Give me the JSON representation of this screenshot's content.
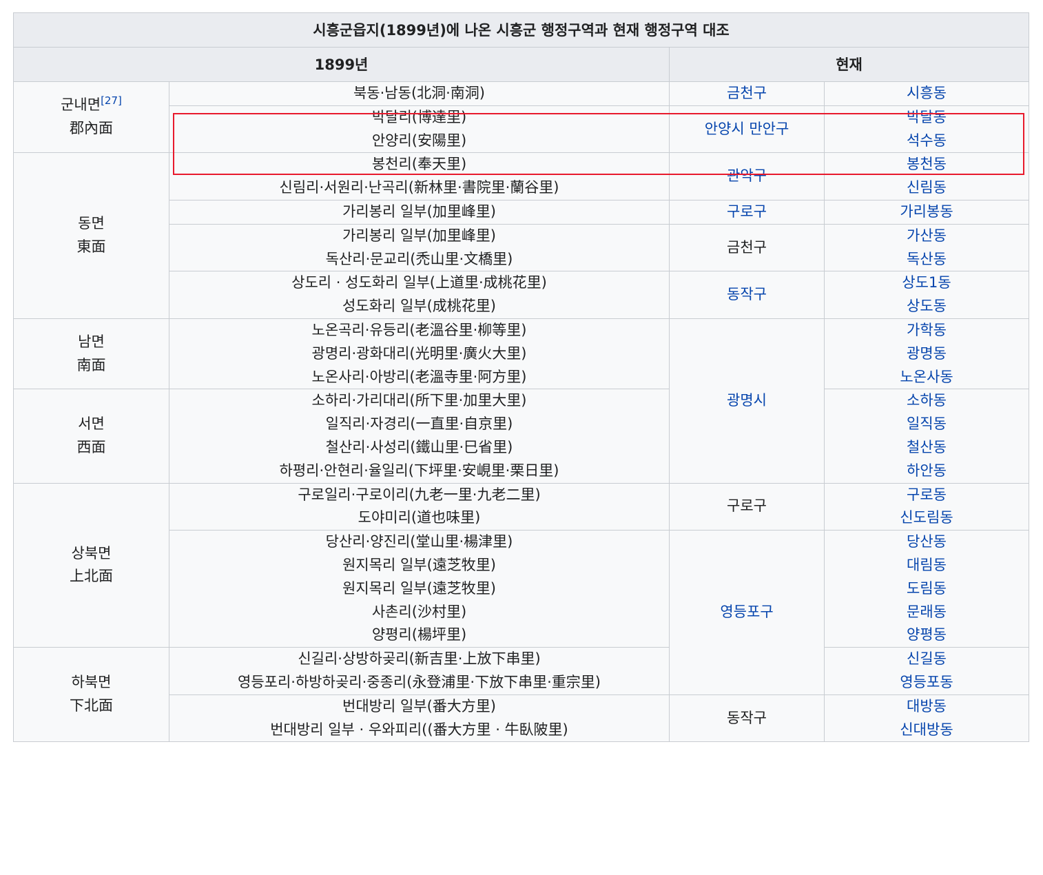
{
  "table": {
    "caption": "시흥군읍지(1899년)에 나온 시흥군 행정구역과 현재 행정구역 대조",
    "header_1899": "1899년",
    "header_current": "현재"
  },
  "myeon": {
    "gunnae": {
      "name": "군내면",
      "hanja": "郡內面",
      "ref": "[27]"
    },
    "dong": {
      "name": "동면",
      "hanja": "東面"
    },
    "nam": {
      "name": "남면",
      "hanja": "南面"
    },
    "seo": {
      "name": "서면",
      "hanja": "西面"
    },
    "sangbuk": {
      "name": "상북면",
      "hanja": "上北面"
    },
    "habuk": {
      "name": "하북면",
      "hanja": "下北面"
    }
  },
  "rows": [
    {
      "ri": [
        "북동·남동(北洞·南洞)"
      ],
      "gu": "금천구",
      "dong": [
        "시흥동"
      ]
    },
    {
      "ri": [
        "박달리(博達里)",
        "안양리(安陽里)"
      ],
      "gu": "안양시 만안구",
      "dong": [
        "박달동",
        "석수동"
      ]
    },
    {
      "ri": [
        "봉천리(奉天里)",
        "신림리·서원리·난곡리(新林里·書院里·蘭谷里)"
      ],
      "gu": "관악구",
      "dong": [
        "봉천동",
        "신림동"
      ]
    },
    {
      "ri": [
        "가리봉리 일부(加里峰里)"
      ],
      "gu": "구로구",
      "dong": [
        "가리봉동"
      ]
    },
    {
      "ri": [
        "가리봉리 일부(加里峰里)",
        "독산리·문교리(禿山里·文橋里)"
      ],
      "gu": "금천구",
      "dong": [
        "가산동",
        "독산동"
      ]
    },
    {
      "ri": [
        "상도리 · 성도화리 일부(上道里·成桃花里)",
        "성도화리 일부(成桃花里)"
      ],
      "gu": "동작구",
      "dong": [
        "상도1동",
        "상도동"
      ]
    },
    {
      "ri": [
        "노온곡리·유등리(老溫谷里·柳等里)",
        "광명리·광화대리(光明里·廣火大里)",
        "노온사리·아방리(老溫寺里·阿方里)"
      ],
      "gu": "광명시",
      "dong": [
        "가학동",
        "광명동",
        "노온사동"
      ]
    },
    {
      "ri": [
        "소하리·가리대리(所下里·加里大里)",
        "일직리·자경리(一直里·自京里)",
        "철산리·사성리(鐵山里·巳省里)",
        "하평리·안현리·율일리(下坪里·安峴里·栗日里)"
      ],
      "dong": [
        "소하동",
        "일직동",
        "철산동",
        "하안동"
      ]
    },
    {
      "ri": [
        "구로일리·구로이리(九老一里·九老二里)",
        "도야미리(道也味里)"
      ],
      "gu": "구로구",
      "dong": [
        "구로동",
        "신도림동"
      ]
    },
    {
      "ri": [
        "당산리·양진리(堂山里·楊津里)",
        "원지목리 일부(遠芝牧里)",
        "원지목리 일부(遠芝牧里)",
        "사촌리(沙村里)",
        "양평리(楊坪里)"
      ],
      "gu": "영등포구",
      "dong": [
        "당산동",
        "대림동",
        "도림동",
        "문래동",
        "양평동"
      ]
    },
    {
      "ri": [
        "신길리·상방하곶리(新吉里·上放下串里)",
        "영등포리·하방하곶리·중종리(永登浦里·下放下串里·重宗里)"
      ],
      "dong": [
        "신길동",
        "영등포동"
      ]
    },
    {
      "ri": [
        "번대방리 일부(番大方里)",
        "번대방리 일부 · 우와피리((番大方里 · 牛臥陂里)"
      ],
      "gu": "동작구",
      "dong": [
        "대방동",
        "신대방동"
      ]
    }
  ]
}
